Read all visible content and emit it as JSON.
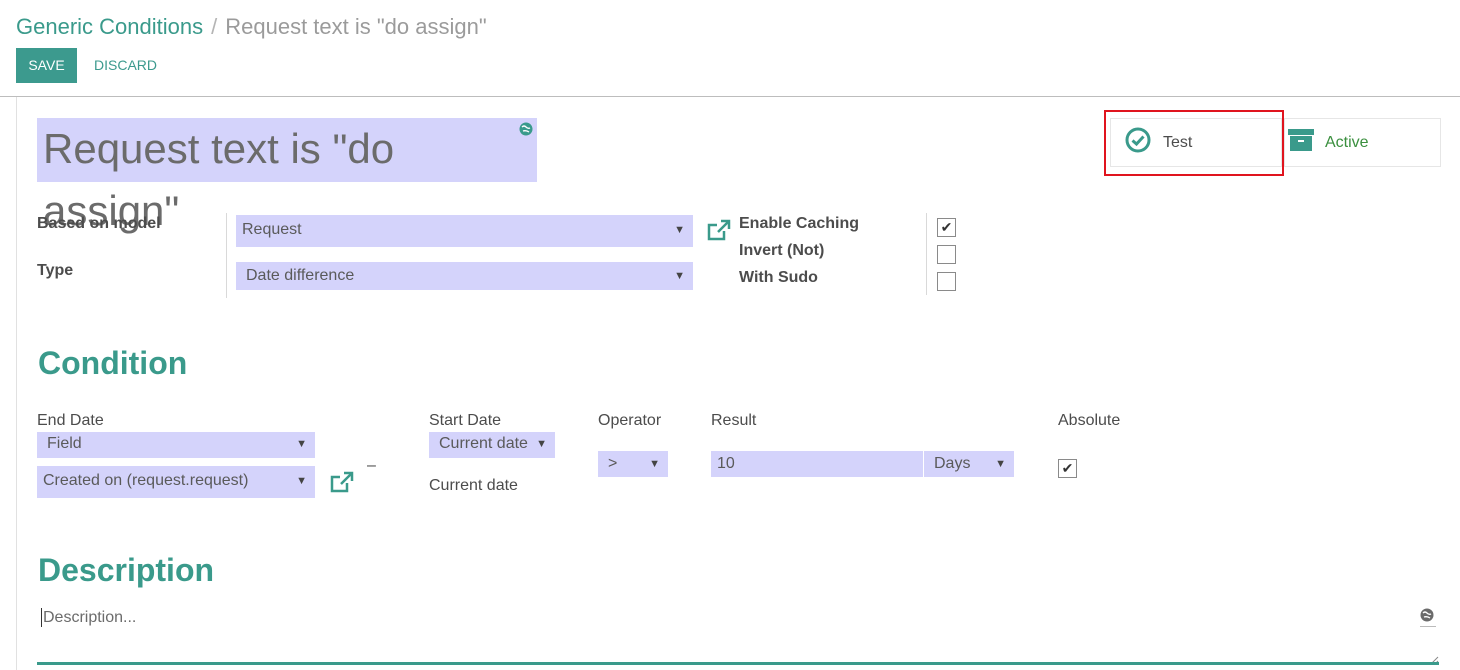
{
  "breadcrumb": {
    "parent": "Generic Conditions",
    "separator": "/",
    "current": "Request text is \"do assign\""
  },
  "toolbar": {
    "save_label": "SAVE",
    "discard_label": "DISCARD"
  },
  "title": "Request text is \"do assign\"",
  "smart_buttons": {
    "test_label": "Test",
    "active_label": "Active"
  },
  "fields": {
    "based_on_model_label": "Based on model",
    "based_on_model_value": "Request",
    "type_label": "Type",
    "type_value": "Date difference",
    "enable_caching_label": "Enable Caching",
    "enable_caching_checked": true,
    "invert_label": "Invert (Not)",
    "invert_checked": false,
    "with_sudo_label": "With Sudo",
    "with_sudo_checked": false
  },
  "condition": {
    "heading": "Condition",
    "end_date_label": "End Date",
    "end_date_type": "Field",
    "end_date_field": "Created on (request.request)",
    "dash": "–",
    "start_date_label": "Start Date",
    "start_date_type": "Current date",
    "start_date_value": "Current date",
    "operator_label": "Operator",
    "operator_value": ">",
    "result_label": "Result",
    "result_value": "10",
    "result_unit": "Days",
    "absolute_label": "Absolute",
    "absolute_checked": true
  },
  "description": {
    "heading": "Description",
    "placeholder": "Description..."
  },
  "colors": {
    "accent": "#3a9a8b",
    "field_bg": "#d4d3fb",
    "highlight": "#e0141e"
  }
}
